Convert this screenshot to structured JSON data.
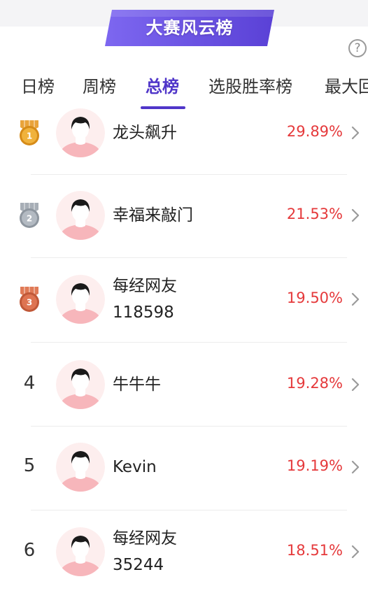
{
  "banner": {
    "title": "大赛风云榜"
  },
  "help": {
    "icon": "question-circle-icon",
    "glyph": "?"
  },
  "tabs": [
    {
      "label": "日榜",
      "active": false
    },
    {
      "label": "周榜",
      "active": false
    },
    {
      "label": "总榜",
      "active": true
    },
    {
      "label": "选股胜率榜",
      "active": false
    },
    {
      "label": "最大回",
      "active": false
    }
  ],
  "colors": {
    "accent": "#5036c9",
    "percent": "#e5393b",
    "gold": "#e8a22a",
    "silver": "#9aa3ad",
    "bronze": "#d5694a"
  },
  "rankings": [
    {
      "rank": "1",
      "medal": "gold-medal-icon",
      "name": [
        "龙头飙升"
      ],
      "percent": "29.89%"
    },
    {
      "rank": "2",
      "medal": "silver-medal-icon",
      "name": [
        "幸福来敲门"
      ],
      "percent": "21.53%"
    },
    {
      "rank": "3",
      "medal": "bronze-medal-icon",
      "name": [
        "每经网友",
        "118598"
      ],
      "percent": "19.50%"
    },
    {
      "rank": "4",
      "medal": "",
      "name": [
        "牛牛牛"
      ],
      "percent": "19.28%"
    },
    {
      "rank": "5",
      "medal": "",
      "name": [
        "Kevin"
      ],
      "percent": "19.19%"
    },
    {
      "rank": "6",
      "medal": "",
      "name": [
        "每经网友",
        "35244"
      ],
      "percent": "18.51%"
    }
  ]
}
